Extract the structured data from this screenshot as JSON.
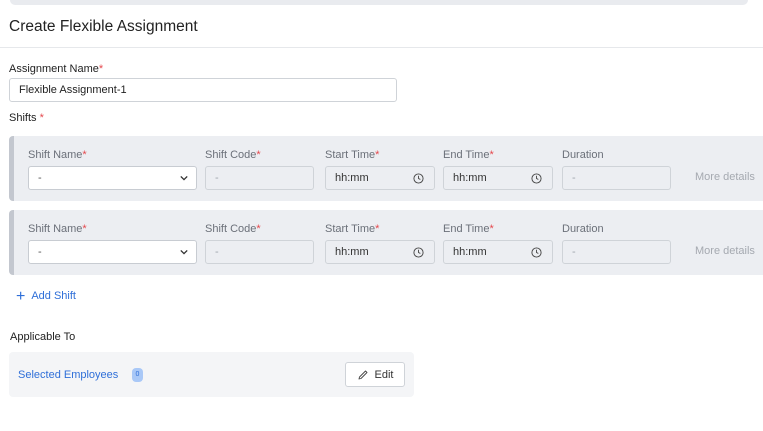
{
  "page": {
    "title": "Create Flexible Assignment"
  },
  "assignment": {
    "label": "Assignment Name",
    "required_mark": "*",
    "value": "Flexible Assignment-1"
  },
  "shifts_section": {
    "label": "Shifts",
    "required_mark": "*"
  },
  "shift_fields": {
    "name_label": "Shift Name",
    "code_label": "Shift Code",
    "start_label": "Start Time",
    "end_label": "End Time",
    "duration_label": "Duration",
    "required_mark": "*"
  },
  "shifts": [
    {
      "name": "-",
      "code": "-",
      "start": "hh:mm",
      "end": "hh:mm",
      "duration": "-",
      "more": "More details"
    },
    {
      "name": "-",
      "code": "-",
      "start": "hh:mm",
      "end": "hh:mm",
      "duration": "-",
      "more": "More details"
    }
  ],
  "add_shift": {
    "icon": "plus-icon",
    "label": "Add Shift"
  },
  "applicable_to": {
    "label": "Applicable To",
    "selected_label": "Selected Employees",
    "selected_count": "0",
    "edit_label": "Edit",
    "edit_icon": "pencil-icon"
  },
  "colors": {
    "accent": "#2f6fd8",
    "required": "#e5484d",
    "card_bg": "#eceef2"
  }
}
